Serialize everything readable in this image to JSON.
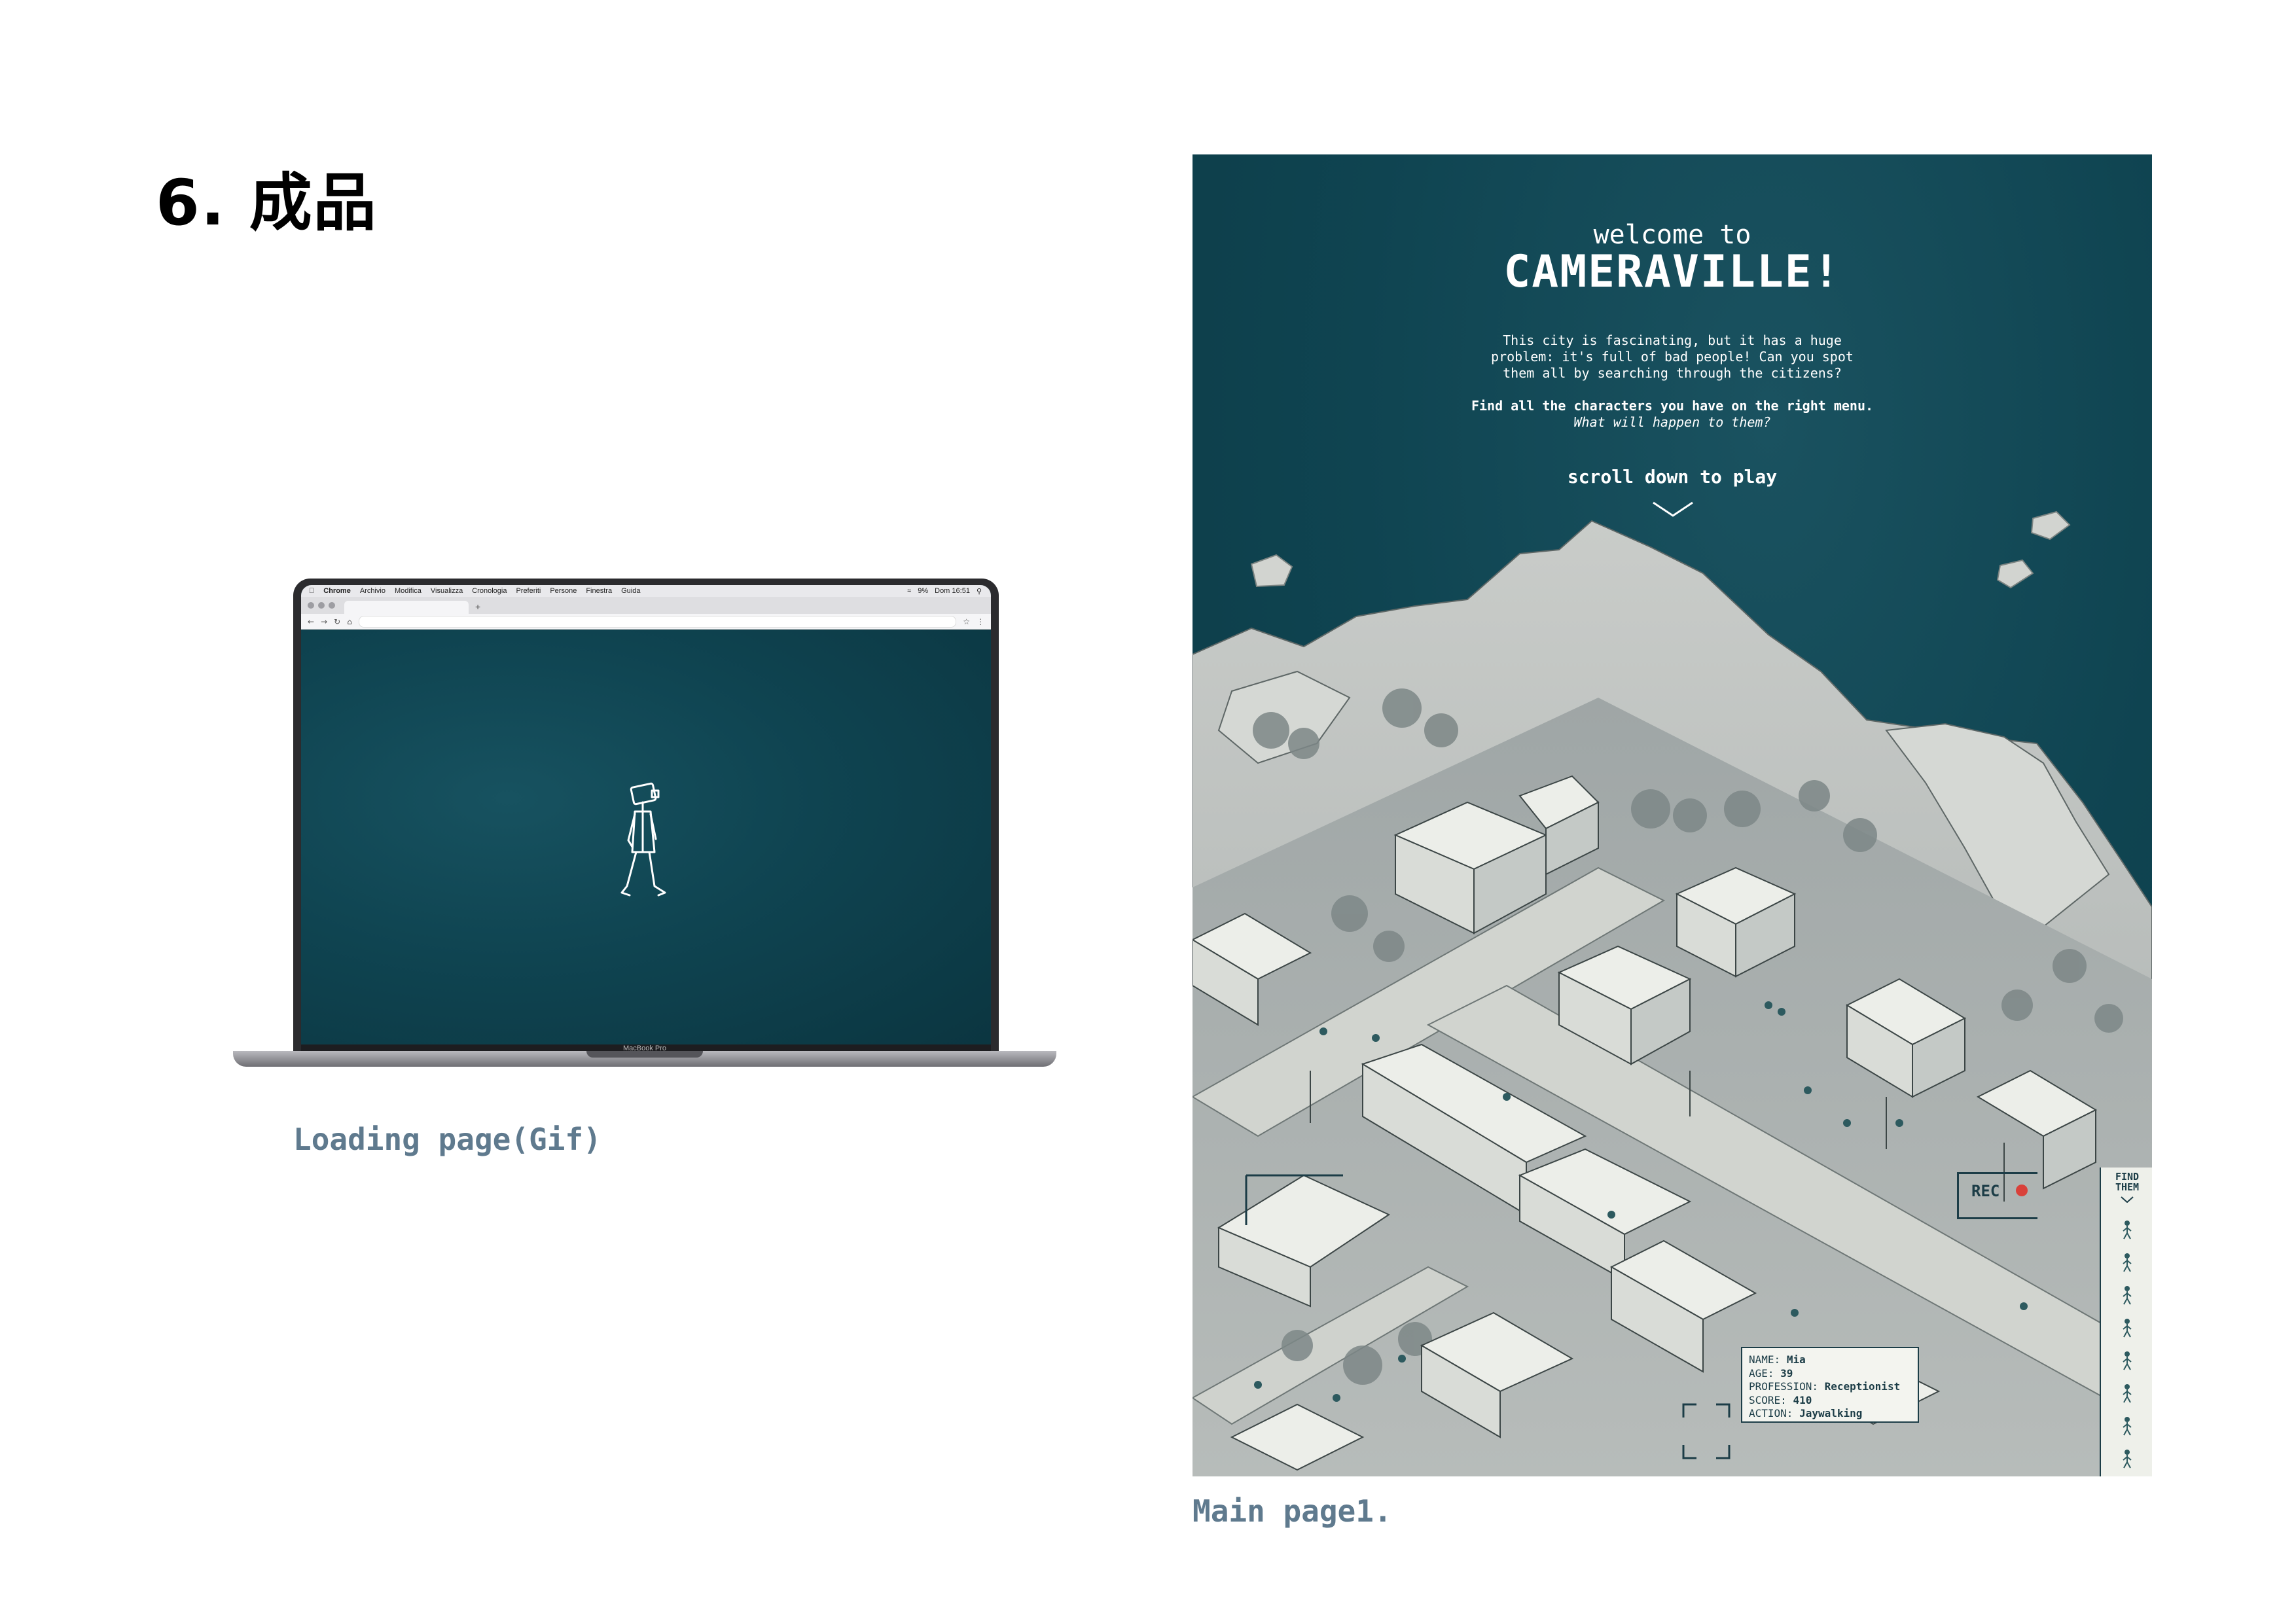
{
  "section_title": "6. 成品",
  "laptop": {
    "menubar_items": [
      "Chrome",
      "Archivio",
      "Modifica",
      "Visualizza",
      "Cronologia",
      "Preferiti",
      "Persone",
      "Finestra",
      "Guida"
    ],
    "menubar_status": [
      "9%",
      "Dom 16:51"
    ],
    "model_label": "MacBook Pro",
    "new_tab": "+"
  },
  "captions": {
    "loading": "Loading page(Gif)",
    "main": "Main page1."
  },
  "poster": {
    "welcome": "welcome to",
    "title": "CAMERAVILLE!",
    "intro_lines": [
      "This city is fascinating, but it has a huge",
      "problem: it's full of bad people! Can you spot",
      "them all by searching through the citizens?"
    ],
    "instruction_bold": "Find all the characters you have on the right menu.",
    "instruction_italic": "What will happen to them?",
    "scroll_label": "scroll down to play",
    "rec_label": "REC",
    "find_panel_title": "FIND THEM",
    "info_card": {
      "name_label": "NAME:",
      "name": "Mia",
      "age_label": "AGE:",
      "age": "39",
      "profession_label": "PROFESSION:",
      "profession": "Receptionist",
      "score_label": "SCORE:",
      "score": "410",
      "action_label": "ACTION:",
      "action": "Jaywalking"
    }
  },
  "colors": {
    "background_teal": "#0f4451",
    "caption_gray_blue": "#5f7a8e",
    "ui_dark": "#1c3d47",
    "rec_red": "#d9413a"
  }
}
